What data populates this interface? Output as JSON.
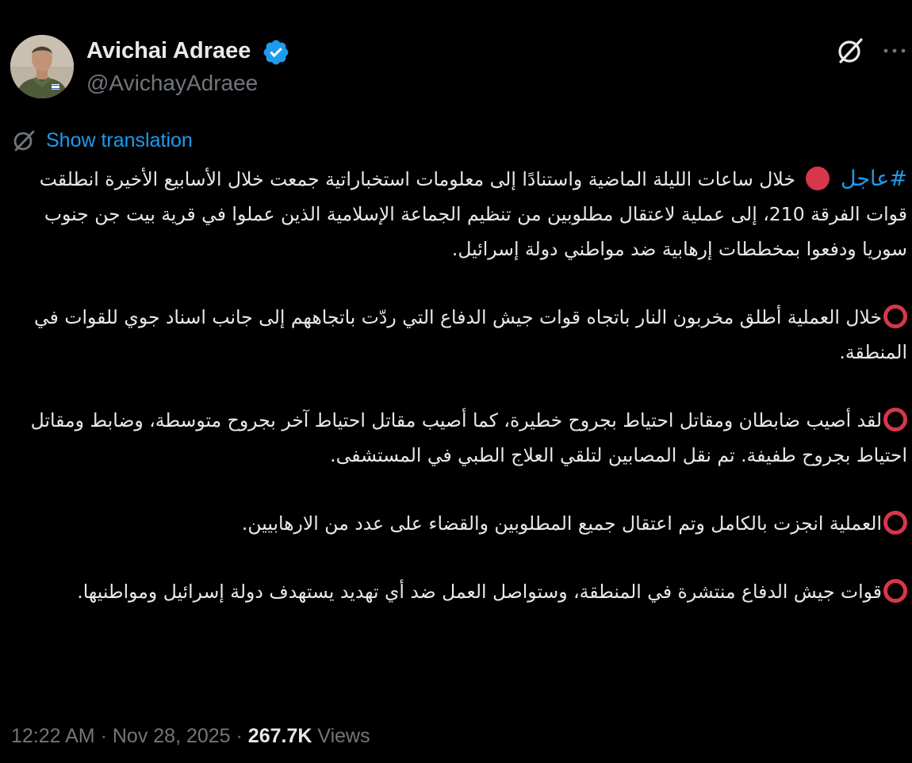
{
  "author": {
    "name": "Avichai Adraee",
    "handle": "@AvichayAdraee",
    "verified": true
  },
  "actions": {
    "translate_icon": "translate-icon",
    "more_icon": "more-icon",
    "more_symbol": "···"
  },
  "translation": {
    "label": "Show translation"
  },
  "body": {
    "hashtag": "#عاجل",
    "p1": "خلال ساعات الليلة الماضية واستنادًا إلى معلومات استخباراتية جمعت خلال الأسابيع الأخيرة انطلقت قوات الفرقة 210، إلى عملية لاعتقال مطلوبين من تنظيم الجماعة الإسلامية الذين عملوا في قرية بيت جن جنوب سوريا ودفعوا بمخططات إرهابية ضد مواطني دولة إسرائيل.",
    "p2": "خلال العملية أطلق مخربون النار باتجاه قوات جيش الدفاع التي ردّت باتجاههم إلى جانب اسناد جوي للقوات في المنطقة.",
    "p3": "لقد أصيب ضابطان ومقاتل احتياط بجروح خطيرة، كما أصيب مقاتل احتياط آخر بجروح متوسطة، وضابط ومقاتل احتياط بجروح طفيفة. تم نقل المصابين لتلقي العلاج الطبي في المستشفى.",
    "p4": "العملية انجزت بالكامل وتم اعتقال جميع المطلوبين والقضاء على عدد من الارهابيين.",
    "p5": "قوات جيش الدفاع منتشرة في المنطقة، وستواصل العمل ضد أي تهديد يستهدف دولة إسرائيل ومواطنيها."
  },
  "meta": {
    "time": "12:22 AM",
    "separator1": " · ",
    "date": "Nov 28, 2025",
    "separator2": " · ",
    "views_count": "267.7K",
    "views_label": " Views"
  },
  "colors": {
    "background": "#000000",
    "text": "#e7e9ea",
    "muted": "#71767b",
    "link": "#1d9bf0",
    "badge": "#1d9bf0",
    "red": "#d8364a"
  }
}
